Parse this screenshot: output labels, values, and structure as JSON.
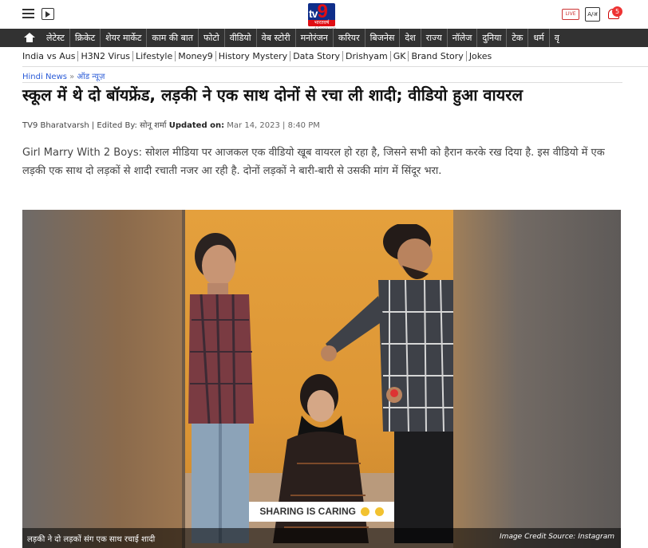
{
  "header": {
    "logo_text": "9",
    "logo_prefix": "tv",
    "logo_strip": "भारतवर्ष",
    "logo_sub": "A Spiesa.com",
    "live_label": "LIVE",
    "lang_label": "A/अ",
    "notification_count": "5"
  },
  "nav": {
    "items": [
      "लेटेस्ट",
      "क्रिकेट",
      "शेयर मार्केट",
      "काम की बात",
      "फोटो",
      "वीडियो",
      "वेब स्टोरी",
      "मनोरंजन",
      "करियर",
      "बिजनेस",
      "देश",
      "राज्य",
      "नॉलेज",
      "दुनिया",
      "टेक",
      "धर्म",
      "वृ"
    ]
  },
  "subnav": {
    "items": [
      "India vs Aus",
      "H3N2 Virus",
      "Lifestyle",
      "Money9",
      "History Mystery",
      "Data Story",
      "Drishyam",
      "GK",
      "Brand Story",
      "Jokes"
    ]
  },
  "breadcrumb": {
    "home": "Hindi News",
    "sep": "»",
    "section": "ऑड न्यूज़"
  },
  "article": {
    "title": "स्कूल में थे दो बॉयफ्रेंड, लड़की ने एक साथ दोनों से रचा ली शादी; वीडियो हुआ वायरल",
    "source": "TV9 Bharatvarsh",
    "edited_by_label": "| Edited By:",
    "editor": "सोनू शर्मा",
    "updated_label": "Updated on:",
    "updated_date": "Mar 14, 2023 | 8:40 PM",
    "lead": "Girl Marry With 2 Boys: सोशल मीडिया पर आजकल एक वीडियो खूब वायरल हो रहा है, जिसने सभी को हैरान करके रख दिया है. इस वीडियो में एक लड़की एक साथ दो लड़कों से शादी रचाती नजर आ रही है. दोनों लड़कों ने बारी-बारी से उसकी मांग में सिंदूर भरा."
  },
  "media": {
    "overlay_text": "SHARING IS CARING",
    "caption": "लड़की ने दो लड़कों संग एक साथ रचाई शादी",
    "credit": "Image Credit Source: Instagram"
  },
  "colors": {
    "nav_bg": "#323232",
    "logo_blue": "#0f2e8a",
    "logo_red": "#e10e14",
    "link_blue": "#2a5bd7"
  },
  "icons": [
    "hamburger-icon",
    "video-play-icon",
    "home-icon",
    "live-tv-icon",
    "language-icon",
    "bell-icon"
  ]
}
